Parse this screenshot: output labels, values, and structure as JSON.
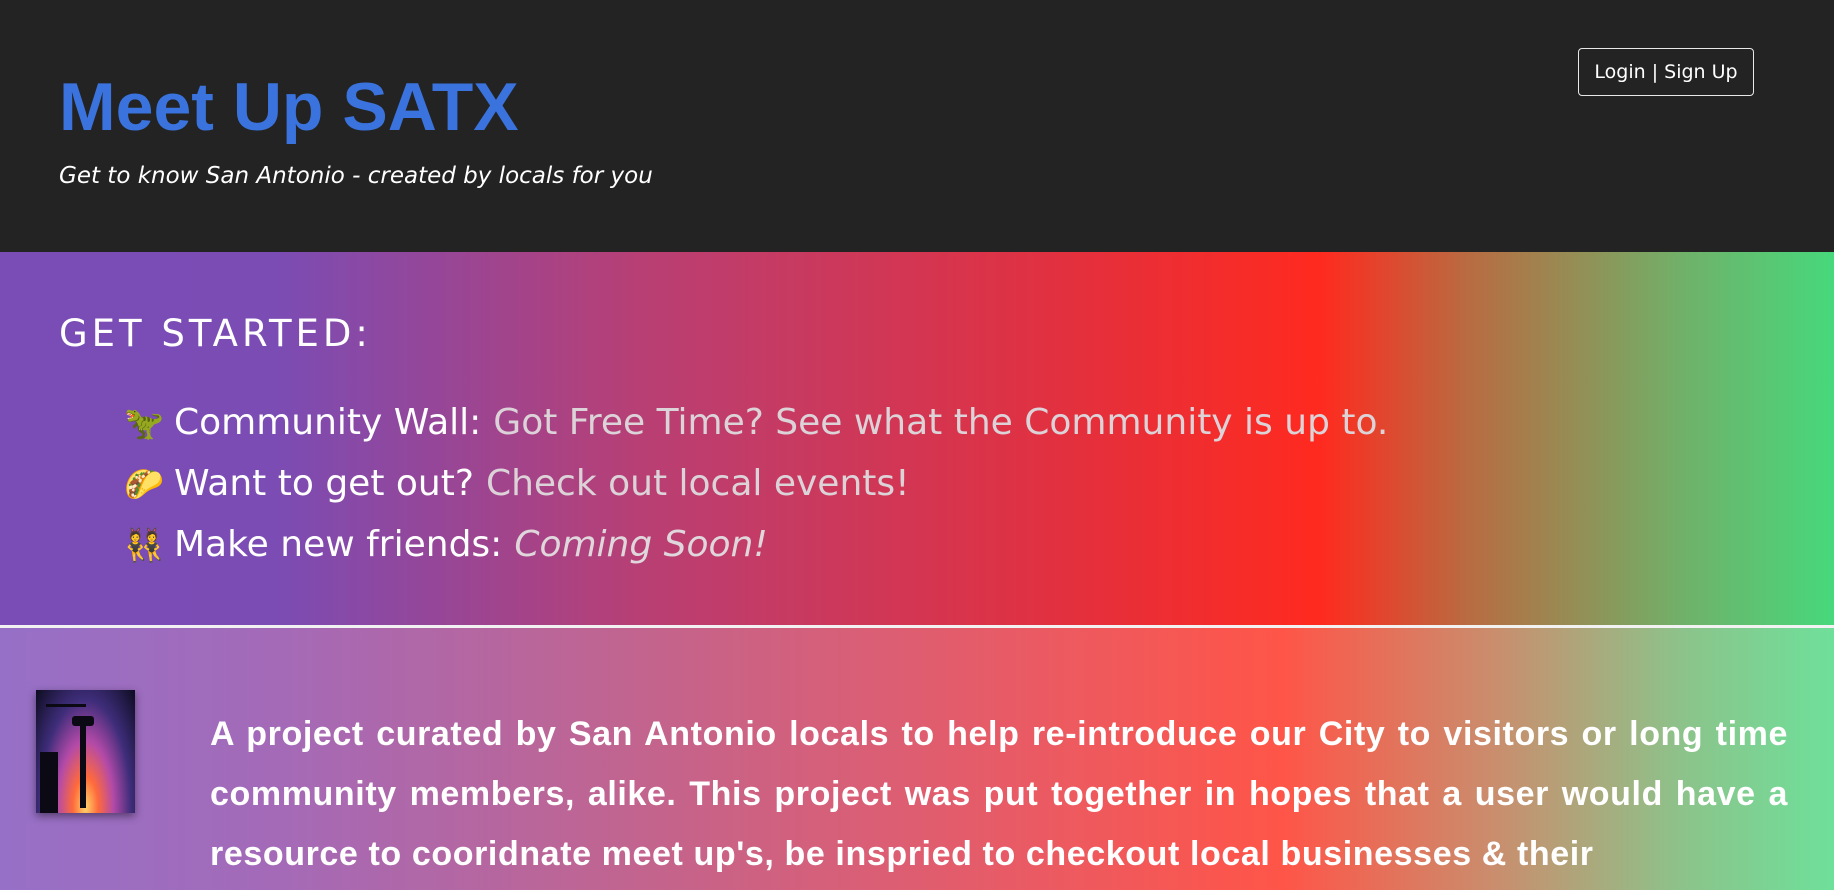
{
  "header": {
    "title": "Meet Up SATX",
    "tagline": "Get to know San Antonio - created by locals for you",
    "auth_button_label": "Login | Sign Up",
    "title_color": "#3a73dd",
    "background_color": "#232323"
  },
  "get_started": {
    "heading": "GET STARTED:",
    "items": [
      {
        "emoji": "🦖",
        "icon": "dinosaur-icon",
        "label": "Community Wall:",
        "link_text": "Got Free Time? See what the Community is up to."
      },
      {
        "emoji": "🌮",
        "icon": "taco-icon",
        "label": "Want to get out?",
        "link_text": "Check out local events!"
      },
      {
        "emoji": "👯",
        "icon": "friends-icon",
        "label": "Make new friends:",
        "link_text": "Coming Soon!"
      }
    ]
  },
  "about": {
    "image_icon": "san-antonio-skyline-photo",
    "text": "A project curated by San Antonio locals to help re-introduce our City to visitors or long time community members, alike. This project was put together in hopes that a user would have a resource to cooridnate meet up's, be inspried to checkout local businesses & their"
  }
}
